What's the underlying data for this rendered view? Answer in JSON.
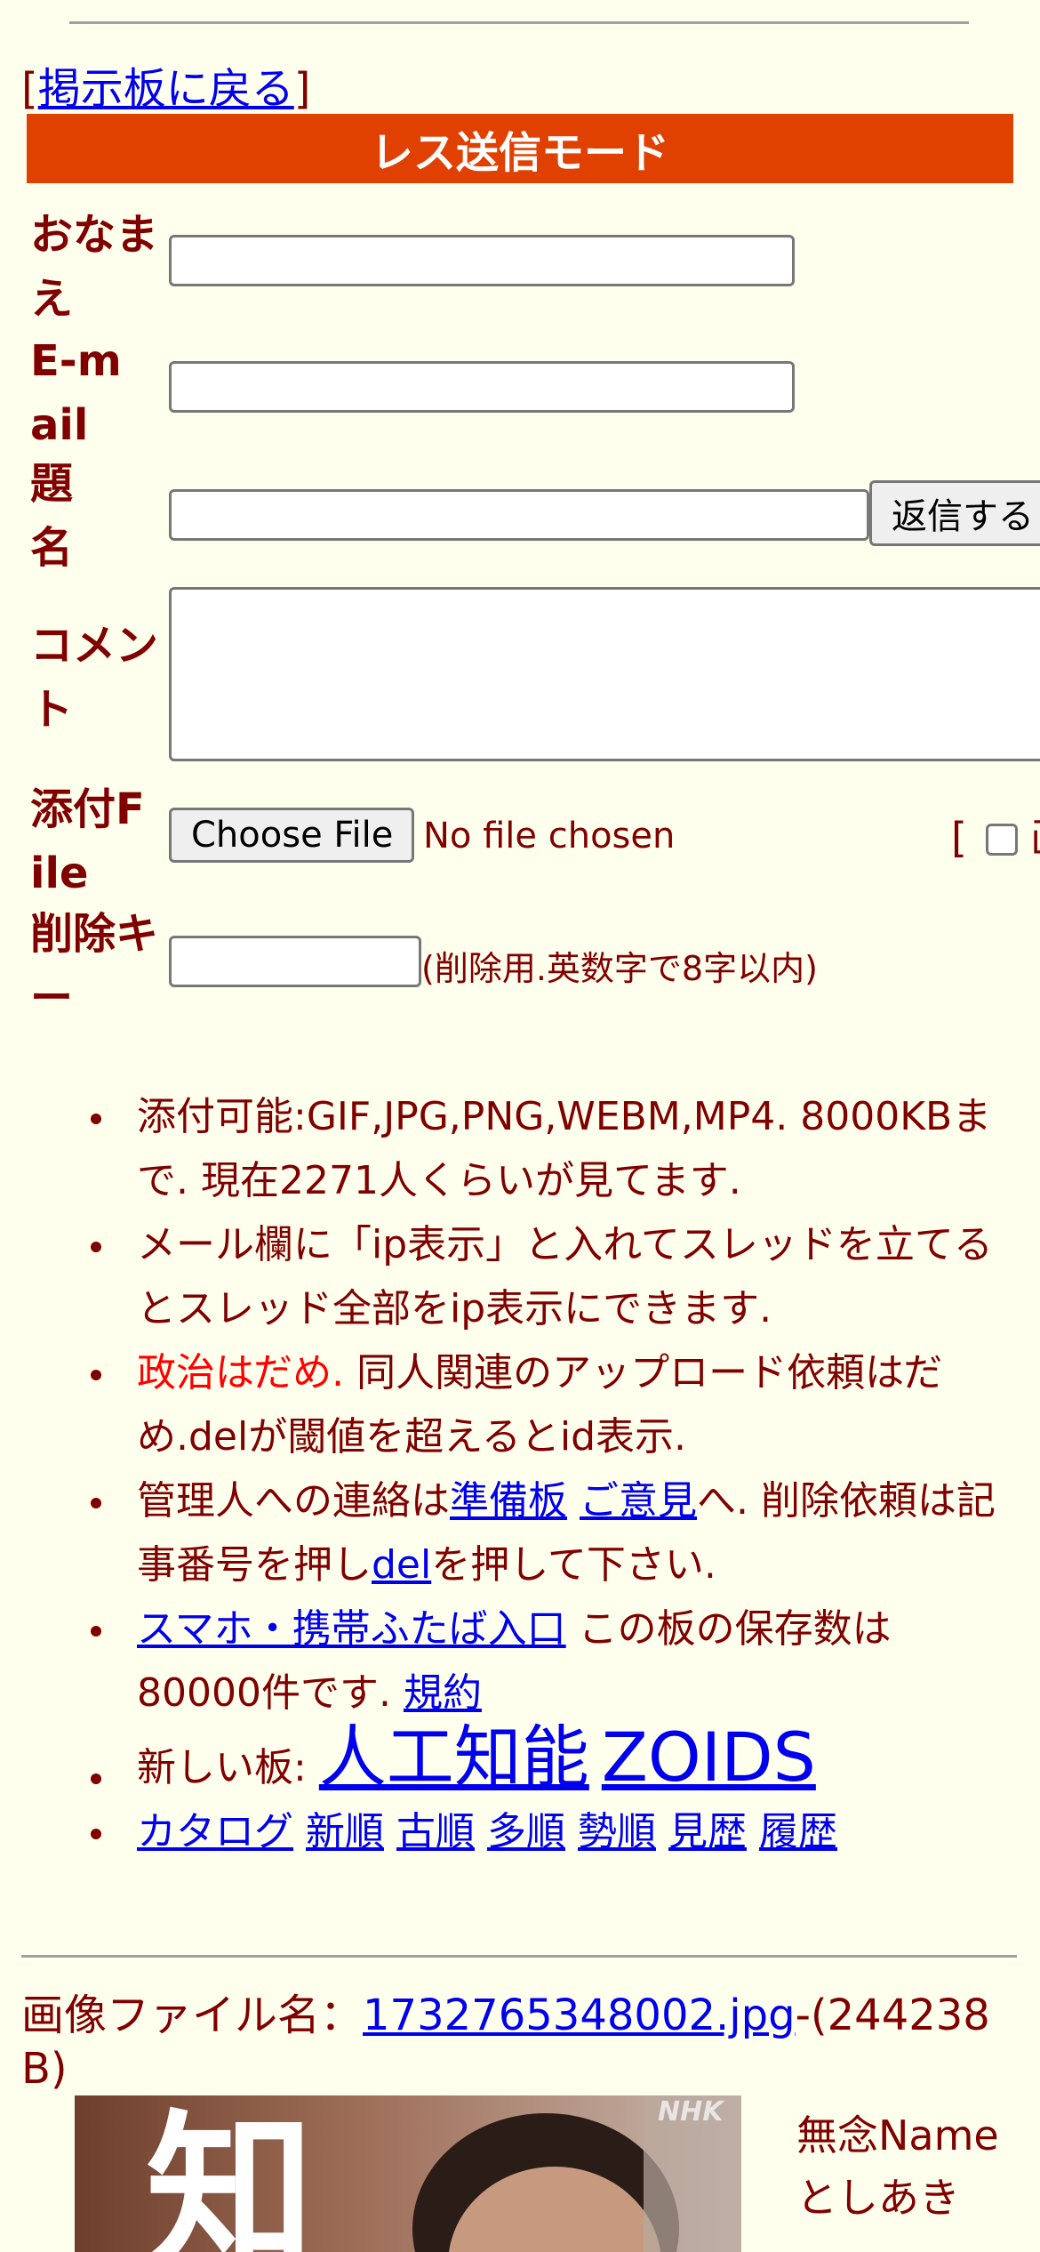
{
  "nav": {
    "back_link": "掲示板に戻る",
    "bracket_open": "[",
    "bracket_close": "]"
  },
  "form": {
    "mode_title": "レス送信モード",
    "labels": {
      "name": "おなまえ",
      "email": "E-mail",
      "subject": "題名",
      "comment": "コメント",
      "attach": "添付File",
      "delkey": "削除キー"
    },
    "values": {
      "name": "",
      "email": "",
      "subject": "",
      "comment": "",
      "delkey": ""
    },
    "submit_label": "返信する",
    "file_button": "Choose File",
    "file_status": "No file chosen",
    "option_bracket": "[",
    "option_clip": "画",
    "delkey_note": "(削除用.英数字で8字以内)"
  },
  "info": {
    "line1": "添付可能:GIF,JPG,PNG,WEBM,MP4. 8000KBまで. 現在2271人くらいが見てます.",
    "line2": "メール欄に「ip表示」と入れてスレッドを立てるとスレッド全部をip表示にできます.",
    "line3_red": "政治はだめ.",
    "line3_rest": " 同人関連のアップロード依頼はだめ.delが閾値を超えるとid表示.",
    "line4_a": "管理人への連絡は",
    "line4_link1": "準備板",
    "line4_link2": "ご意見",
    "line4_b": "へ. 削除依頼は記事番号を押し",
    "line4_link3": "del",
    "line4_c": "を押して下さい.",
    "line5_link": "スマホ・携帯ふたば入口",
    "line5_text": " この板の保存数は80000件です. ",
    "line5_link2": "規約",
    "line6_label": "新しい板: ",
    "line6_link1": "人工知能",
    "line6_link2": "ZOIDS",
    "catalog_links": [
      "カタログ",
      "新順",
      "古順",
      "多順",
      "勢順",
      "見歴",
      "履歴"
    ]
  },
  "post": {
    "file_label": "画像ファイル名：",
    "file_link": "1732765348002.jpg",
    "file_size": "-(244238 B)",
    "thumb_text": "知",
    "thumb_watermark": "NHK",
    "subject": "無念",
    "name_label": "Name",
    "name_value": "としあき"
  }
}
